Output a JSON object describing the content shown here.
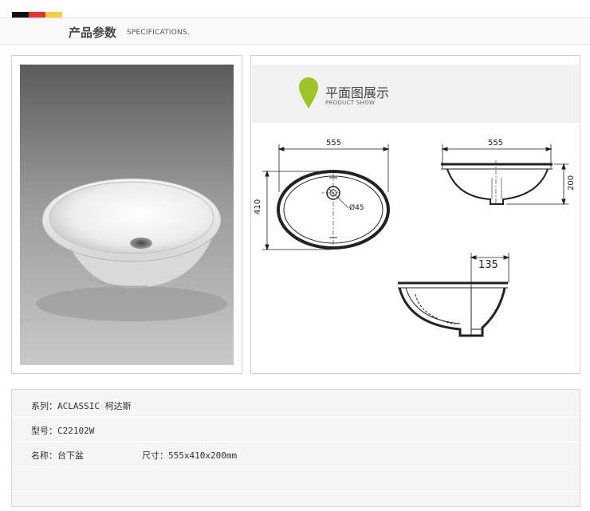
{
  "header": {
    "title_cn": "产品参数",
    "title_en": "SPECIFICATIONS.",
    "flag_colors": [
      "#111111",
      "#e8322b",
      "#f4d03f"
    ]
  },
  "product_show": {
    "title_cn": "平面图展示",
    "title_en": "PRODUCT SHOW",
    "pin_color": "#9fc42a"
  },
  "drawings": {
    "top_width": "555",
    "top_depth": "410",
    "drain": "Ø45",
    "side_width": "555",
    "side_height": "200",
    "section_offset": "135"
  },
  "specs": {
    "series": "系列：ACLASSIC 柯达斯",
    "model": "型号：C22102W",
    "name": "名称：台下盆",
    "size": "尺寸：555x410x200mm"
  }
}
